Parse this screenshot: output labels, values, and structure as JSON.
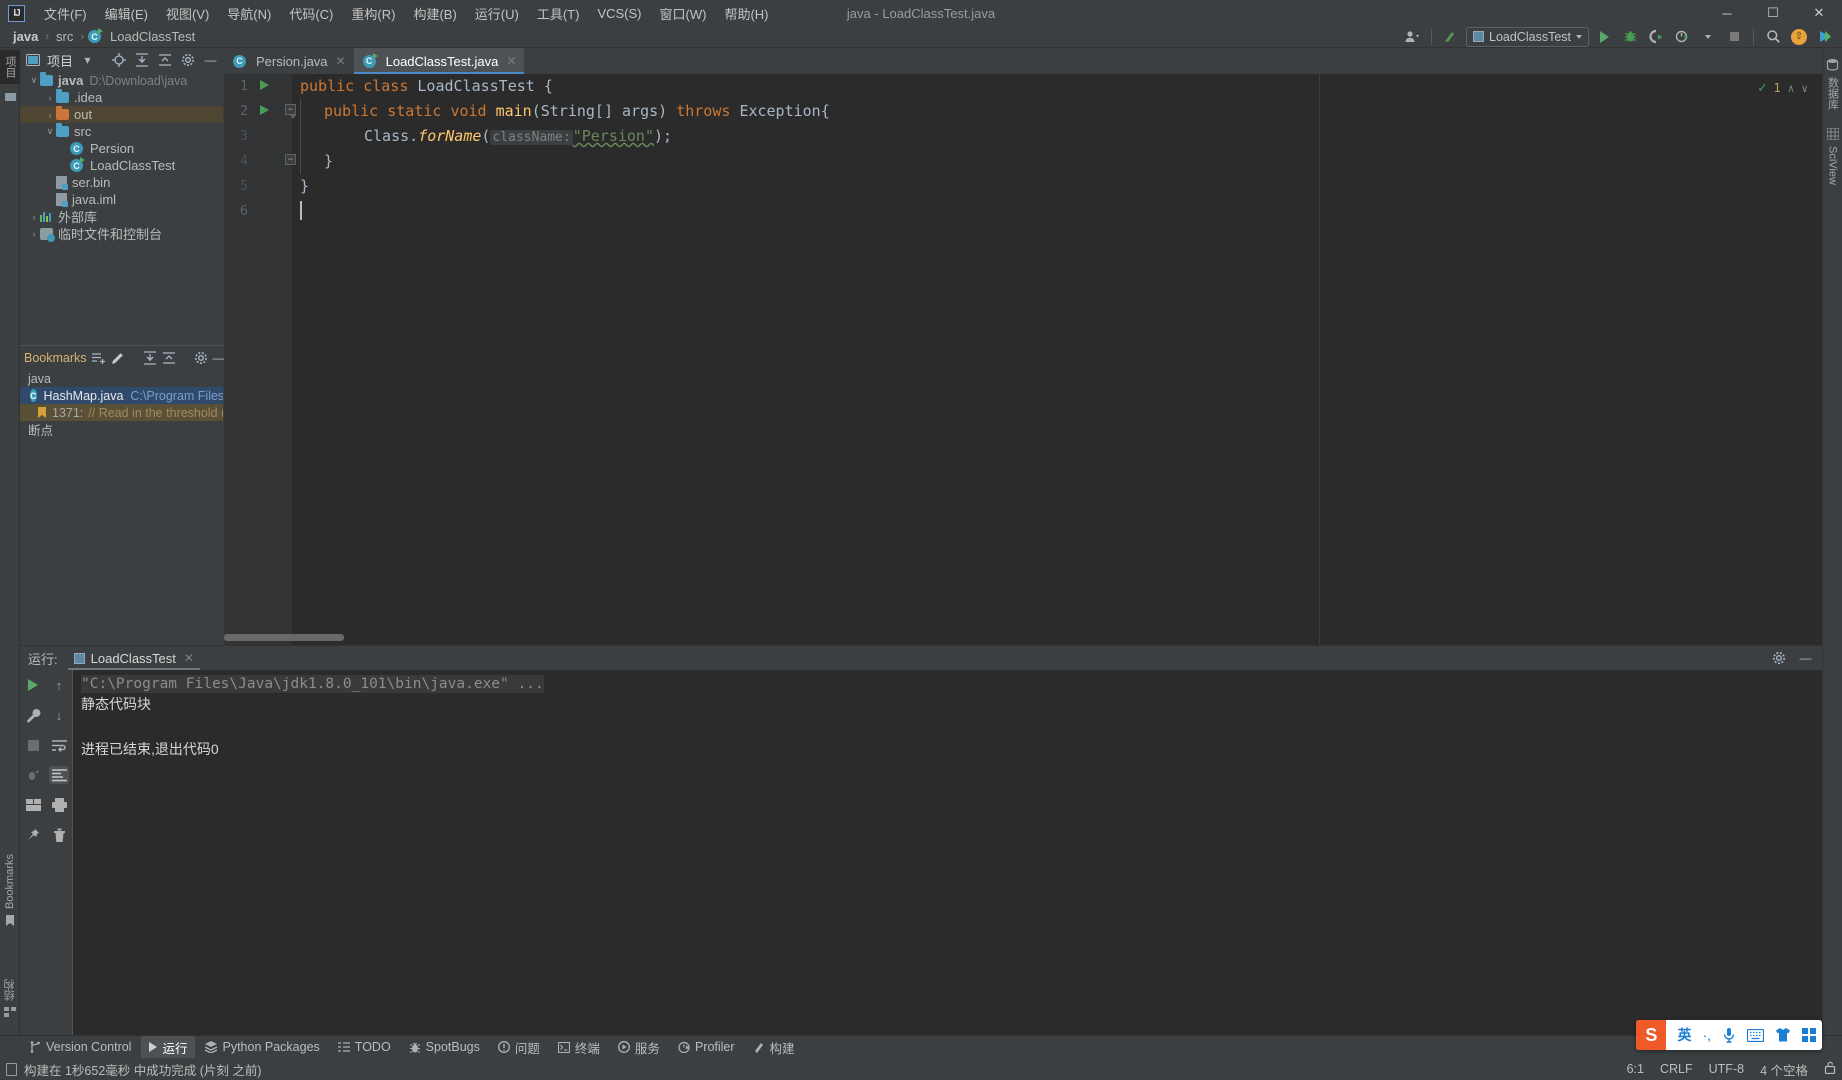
{
  "window": {
    "title": "java - LoadClassTest.java",
    "logo": "IJ",
    "minimize": "─",
    "maximize": "☐",
    "close": "✕"
  },
  "menu": {
    "items": [
      {
        "label": "文件(F)",
        "name": "menu-file"
      },
      {
        "label": "编辑(E)",
        "name": "menu-edit"
      },
      {
        "label": "视图(V)",
        "name": "menu-view"
      },
      {
        "label": "导航(N)",
        "name": "menu-navigate"
      },
      {
        "label": "代码(C)",
        "name": "menu-code"
      },
      {
        "label": "重构(R)",
        "name": "menu-refactor"
      },
      {
        "label": "构建(B)",
        "name": "menu-build"
      },
      {
        "label": "运行(U)",
        "name": "menu-run"
      },
      {
        "label": "工具(T)",
        "name": "menu-tools"
      },
      {
        "label": "VCS(S)",
        "name": "menu-vcs"
      },
      {
        "label": "窗口(W)",
        "name": "menu-window"
      },
      {
        "label": "帮助(H)",
        "name": "menu-help"
      }
    ]
  },
  "navbar": {
    "crumbs": [
      "java",
      "src",
      "LoadClassTest"
    ],
    "separator": "›"
  },
  "toolbar": {
    "run_config": "LoadClassTest",
    "settings_icon": "gear-icon",
    "search_icon": "search-icon",
    "run_icon": "run-icon",
    "debug_icon": "debug-icon",
    "coverage_icon": "coverage-icon",
    "profile_icon": "profile-icon",
    "stop_icon": "stop-icon",
    "updates_icon": "update-badge-icon",
    "account_icon": "account-icon"
  },
  "left_strip": {
    "project_label": "项目",
    "structure_label": "结构",
    "bookmarks_label": "Bookmarks"
  },
  "right_strip": {
    "database_label": "数据库",
    "sciview_label": "SciView"
  },
  "project_panel": {
    "title": "项目",
    "tree": [
      {
        "label": "java",
        "detail": "D:\\Download\\java",
        "depth": 0,
        "arrow": "∨",
        "icon": "module-folder",
        "bold": true,
        "selected": false
      },
      {
        "label": ".idea",
        "detail": "",
        "depth": 1,
        "arrow": "›",
        "icon": "folder-blue",
        "bold": false,
        "selected": false
      },
      {
        "label": "out",
        "detail": "",
        "depth": 1,
        "arrow": "›",
        "icon": "folder-orange",
        "bold": false,
        "selected": true
      },
      {
        "label": "src",
        "detail": "",
        "depth": 1,
        "arrow": "∨",
        "icon": "folder-blue",
        "bold": false,
        "selected": false
      },
      {
        "label": "Persion",
        "detail": "",
        "depth": 2,
        "arrow": "",
        "icon": "class",
        "bold": false,
        "selected": false
      },
      {
        "label": "LoadClassTest",
        "detail": "",
        "depth": 2,
        "arrow": "",
        "icon": "class-runnable",
        "bold": false,
        "selected": false
      },
      {
        "label": "ser.bin",
        "detail": "",
        "depth": 1,
        "arrow": "",
        "icon": "file-unknown",
        "bold": false,
        "selected": false
      },
      {
        "label": "java.iml",
        "detail": "",
        "depth": 1,
        "arrow": "",
        "icon": "file-iml",
        "bold": false,
        "selected": false
      },
      {
        "label": "外部库",
        "detail": "",
        "depth": 0,
        "arrow": "›",
        "icon": "library",
        "bold": false,
        "selected": false
      },
      {
        "label": "临时文件和控制台",
        "detail": "",
        "depth": 0,
        "arrow": "›",
        "icon": "scratches",
        "bold": false,
        "selected": false
      }
    ]
  },
  "bookmarks_panel": {
    "title": "Bookmarks",
    "rows": [
      {
        "kind": "group",
        "label": "java"
      },
      {
        "kind": "file",
        "label": "HashMap.java",
        "path": "C:\\Program Files\\Java",
        "selected": true
      },
      {
        "kind": "line",
        "number": "1371:",
        "comment": "// Read in the threshold (ign",
        "highlight": true
      },
      {
        "kind": "group",
        "label": "断点"
      }
    ]
  },
  "editor": {
    "tabs": [
      {
        "label": "Persion.java",
        "icon": "class-icon",
        "active": false
      },
      {
        "label": "LoadClassTest.java",
        "icon": "class-runnable-icon",
        "active": true
      }
    ],
    "line_numbers": [
      "1",
      "2",
      "3",
      "4",
      "5",
      "6"
    ],
    "code": {
      "l1_kw1": "public",
      "l1_kw2": "class",
      "l1_name": "LoadClassTest",
      "l1_brace": "{",
      "l2_kw1": "public",
      "l2_kw2": "static",
      "l2_kw3": "void",
      "l2_mth": "main",
      "l2_params": "(String[] args)",
      "l2_kw4": "throws",
      "l2_exc": "Exception{",
      "l3_cls": "Class.",
      "l3_mth": "forName",
      "l3_open": "(",
      "l3_hint": "className:",
      "l3_str": "\"Persion\"",
      "l3_close": ");",
      "l4_brace": "}",
      "l5_brace": "}"
    },
    "inspection": {
      "status": "check-ok",
      "count": "1",
      "up": "∧",
      "down": "∨"
    }
  },
  "run_window": {
    "label": "运行:",
    "tab": "LoadClassTest",
    "console": {
      "command": "\"C:\\Program Files\\Java\\jdk1.8.0_101\\bin\\java.exe\" ...",
      "line2": "静态代码块",
      "line3": "进程已结束,退出代码0"
    },
    "icons": {
      "rerun": "run-icon",
      "settings": "wrench-icon",
      "stop": "stop-icon",
      "debug": "debug-exit-icon",
      "layout": "layout-icon",
      "pin": "pin-icon",
      "up": "arrow-up-icon",
      "down": "arrow-down-icon",
      "soft_wrap": "soft-wrap-icon",
      "scroll_end": "scroll-to-end-icon",
      "print": "print-icon",
      "clear": "trash-icon"
    }
  },
  "bottom_tabs": [
    {
      "label": "Version Control",
      "icon": "branch-icon",
      "active": false
    },
    {
      "label": "运行",
      "icon": "run-icon",
      "active": true
    },
    {
      "label": "Python Packages",
      "icon": "packages-icon",
      "active": false
    },
    {
      "label": "TODO",
      "icon": "todo-icon",
      "active": false
    },
    {
      "label": "SpotBugs",
      "icon": "bug-icon",
      "active": false
    },
    {
      "label": "问题",
      "icon": "problems-icon",
      "active": false
    },
    {
      "label": "终端",
      "icon": "terminal-icon",
      "active": false
    },
    {
      "label": "服务",
      "icon": "services-icon",
      "active": false
    },
    {
      "label": "Profiler",
      "icon": "profiler-icon",
      "active": false
    },
    {
      "label": "构建",
      "icon": "build-icon",
      "active": false
    }
  ],
  "statusbar": {
    "message": "构建在 1秒652毫秒 中成功完成 (片刻 之前)",
    "caret": "6:1",
    "line_sep": "CRLF",
    "encoding": "UTF-8",
    "indent": "4 个空格",
    "lock_icon": "lock-icon"
  },
  "ime": {
    "logo": "S",
    "mode": "英",
    "punct": "·,",
    "voice_icon": "microphone-icon",
    "keyboard_icon": "keyboard-icon",
    "skin_icon": "shirt-icon",
    "apps_icon": "apps-grid-icon"
  },
  "colors": {
    "bg_panel": "#3c3f41",
    "bg_editor": "#2b2b2b",
    "accent_blue": "#4a88c7",
    "keyword": "#cc7832",
    "string": "#6a8759",
    "method": "#ffc66d",
    "plain": "#a9b7c6",
    "selection": "#4e4633",
    "bookmark_sel": "#2f4a6b"
  }
}
